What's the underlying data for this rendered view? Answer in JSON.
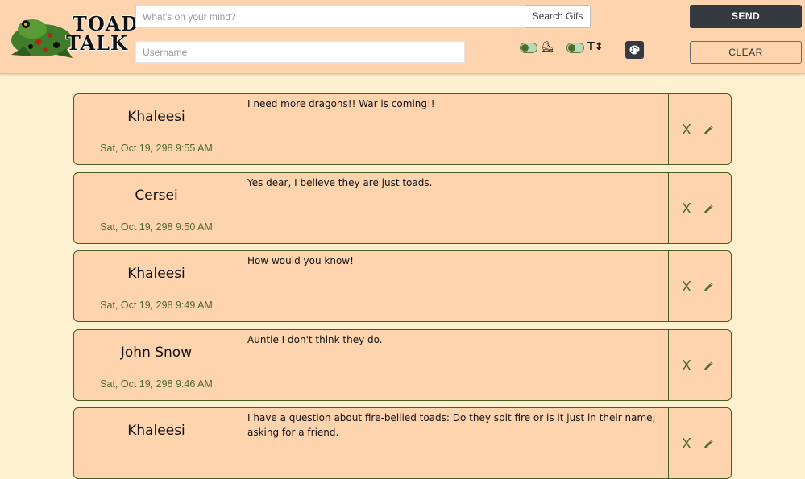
{
  "app": {
    "logo_line1": "TOAD",
    "logo_line2": "TALK"
  },
  "composer": {
    "message_placeholder": "What's on your mind?",
    "gif_button": "Search Gifs",
    "username_placeholder": "Username",
    "send_label": "SEND",
    "clear_label": "CLEAR"
  },
  "toggles": [
    {
      "icon": "boot-icon",
      "glyph": "⛸"
    },
    {
      "icon": "text-size-icon",
      "glyph": "T↕"
    }
  ],
  "colors": {
    "header_bg": "#fdd4ad",
    "page_bg": "#fdf0cf",
    "accent_green": "#4d6b2f",
    "dark_button": "#343a40"
  },
  "messages": [
    {
      "name": "Khaleesi",
      "date": "Sat, Oct 19, 298 9:55 AM",
      "text": "I need more dragons!! War is coming!!",
      "delete": "X"
    },
    {
      "name": "Cersei",
      "date": "Sat, Oct 19, 298 9:50 AM",
      "text": "Yes dear, I believe they are just toads.",
      "delete": "X"
    },
    {
      "name": "Khaleesi",
      "date": "Sat, Oct 19, 298 9:49 AM",
      "text": "How would you know!",
      "delete": "X"
    },
    {
      "name": "John Snow",
      "date": "Sat, Oct 19, 298 9:46 AM",
      "text": "Auntie I don't think they do.",
      "delete": "X"
    },
    {
      "name": "Khaleesi",
      "date": "",
      "text": "I have a question about fire-bellied toads: Do they spit fire or is it just in their name; asking for a friend.",
      "delete": "X"
    }
  ]
}
